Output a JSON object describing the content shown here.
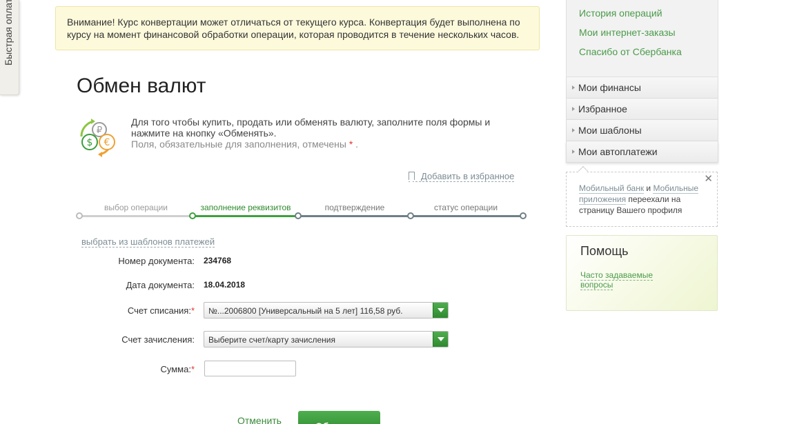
{
  "quick_tab": {
    "label": "Быстрая оплата"
  },
  "warning": {
    "text": "Внимание! Курс конвертации может отличаться от текущего курса. Конвертация будет выполнена по курсу на момент финансовой обработки операции, которая проводится в течение нескольких часов."
  },
  "page": {
    "title": "Обмен валют",
    "intro": "Для того чтобы купить, продать или обменять валюту, заполните поля формы и нажмите на кнопку «Обменять».",
    "required_hint": "Поля, обязательные для заполнения, отмечены",
    "required_mark": "*",
    "required_end": ".",
    "add_favorite": "Добавить в избранное",
    "templates_link": "выбрать из шаблонов платежей"
  },
  "stepper": {
    "steps": [
      {
        "label": "выбор операции",
        "state": "done"
      },
      {
        "label": "заполнение реквизитов",
        "state": "active"
      },
      {
        "label": "подтверждение",
        "state": "pending"
      },
      {
        "label": "статус операции",
        "state": "pending"
      }
    ]
  },
  "form": {
    "doc_number_label": "Номер документа:",
    "doc_number_value": "234768",
    "doc_date_label": "Дата документа:",
    "doc_date_value": "18.04.2018",
    "debit_label": "Счет списания:",
    "debit_value": "№...2006800  [Универсальный на 5 лет] 116,58  руб.",
    "credit_label": "Счет зачисления:",
    "credit_placeholder": "Выберите счет/карту зачисления",
    "amount_label": "Сумма:",
    "required_mark": "*",
    "cancel_label": "Отменить",
    "submit_label": "Обменять"
  },
  "sidebar": {
    "links": [
      "История операций",
      "Мои интернет-заказы",
      "Спасибо от Сбербанка"
    ],
    "menu": [
      "Мои финансы",
      "Избранное",
      "Мои шаблоны",
      "Мои автоплатежи"
    ]
  },
  "notice": {
    "link1": "Мобильный банк",
    "and": " и ",
    "link2": "Мобильные приложения",
    "rest": " переехали на страницу Вашего профиля",
    "close": "✕"
  },
  "help": {
    "title": "Помощь",
    "faq": "Часто задаваемые вопросы"
  },
  "colors": {
    "accent_green": "#2f8a2f",
    "link_green": "#4a9a4a",
    "warning_bg": "#fdfadc",
    "required_red": "#e2332a"
  }
}
